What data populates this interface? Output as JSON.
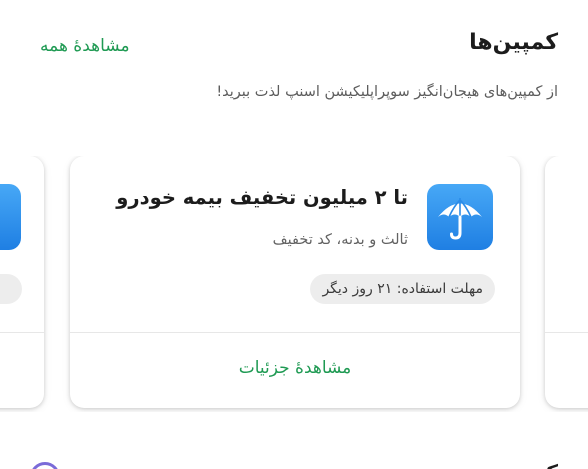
{
  "section": {
    "title": "کمپین‌ها",
    "see_all_label": "مشاهدهٔ همه",
    "subtitle": "از کمپین‌های هیجان‌انگیز سوپراپلیکیشن اسنپ لذت ببرید!"
  },
  "campaign_card": {
    "icon": "umbrella-icon",
    "title": "تا ۲ میلیون تخفیف بیمه خودرو",
    "description": "ثالث و بدنه، کد تخفیف",
    "badge": "مهلت استفاده: ۲۱ روز دیگر",
    "action_label": "مشاهدهٔ جزئیات"
  },
  "next_section": {
    "title": "کمپ‌ ‌‌"
  },
  "colors": {
    "accent_green": "#1f9a53",
    "icon_blue": "#2b8ce8",
    "badge_bg": "#ededed"
  }
}
